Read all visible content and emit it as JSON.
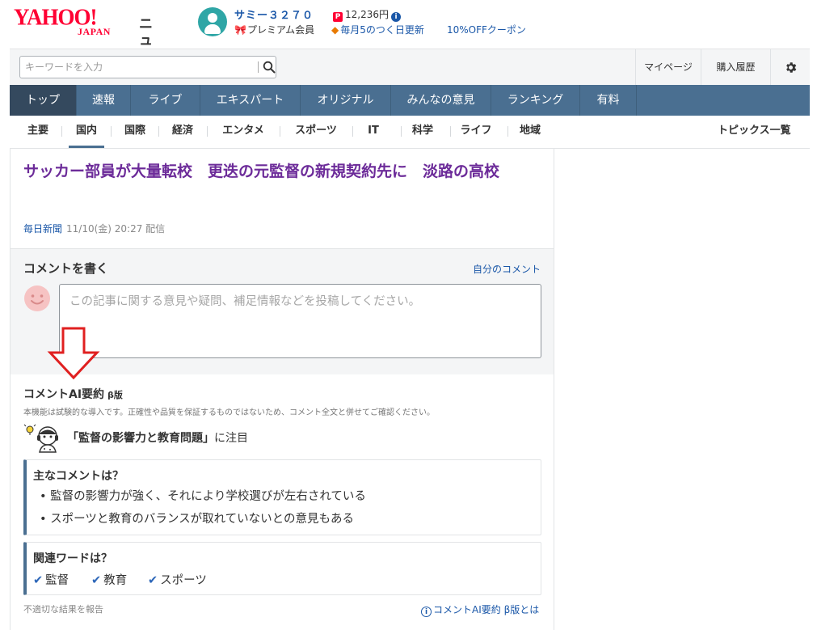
{
  "header": {
    "logo_text": "YAHOO!",
    "logo_sub": "JAPAN",
    "service_name": "ニュース",
    "user_name": "サミー３２７０",
    "membership": "プレミアム会員",
    "points": "12,236円",
    "campaign": "毎月5のつく日更新",
    "coupon": "10%OFFクーポン"
  },
  "search": {
    "placeholder": "キーワードを入力"
  },
  "header_links": {
    "mypage": "マイページ",
    "history": "購入履歴"
  },
  "main_nav": [
    "トップ",
    "速報",
    "ライブ",
    "エキスパート",
    "オリジナル",
    "みんなの意見",
    "ランキング",
    "有料"
  ],
  "sub_nav": [
    "主要",
    "国内",
    "国際",
    "経済",
    "エンタメ",
    "スポーツ",
    "IT",
    "科学",
    "ライフ",
    "地域"
  ],
  "topics_link": "トピックス一覧",
  "article": {
    "title": "サッカー部員が大量転校　更迭の元監督の新規契約先に　淡路の高校",
    "source": "毎日新聞",
    "datetime": "11/10(金) 20:27 配信"
  },
  "comment_write": {
    "title": "コメントを書く",
    "my_comments": "自分のコメント",
    "placeholder": "この記事に関する意見や疑問、補足情報などを投稿してください。"
  },
  "ai_summary": {
    "title": "コメントAI要約",
    "beta": "β版",
    "note": "本機能は試験的な導入です。正確性や品質を保証するものではないため、コメント全文と併せてご確認ください。",
    "focus_keyword": "「監督の影響力と教育問題」",
    "focus_suffix": "に注目",
    "main_title": "主なコメントは？",
    "main_points": [
      "• 監督の影響力が強く、それにより学校選びが左右されている",
      "• スポーツと教育のバランスが取れていないとの意見もある"
    ],
    "related_title": "関連ワードは？",
    "related_words": [
      "監督",
      "教育",
      "スポーツ"
    ],
    "report": "不適切な結果を報告",
    "about": "コメントAI要約 β版とは"
  },
  "colors": {
    "accent_red": "#ff0033",
    "nav_blue": "#4a6f91",
    "nav_active": "#34495e",
    "link_blue": "#1a57a8",
    "title_purple": "#6c2b99",
    "arrow_red": "#e02020"
  },
  "icons": [
    "avatar-icon",
    "premium-gift-icon",
    "paypay-icon",
    "info-icon",
    "fire-icon",
    "search-icon",
    "gear-icon",
    "smile-icon",
    "down-arrow-icon",
    "robot-icon",
    "check-icon"
  ]
}
